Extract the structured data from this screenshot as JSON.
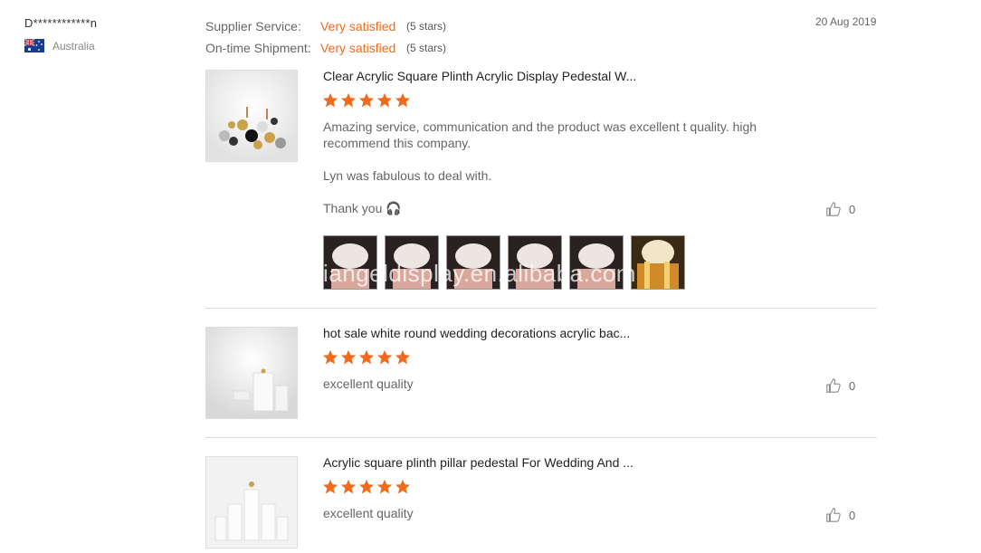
{
  "buyer": {
    "name": "D************n",
    "country": "Australia",
    "flag_icon": "australia-flag-icon"
  },
  "ratings": [
    {
      "label": "Supplier Service:",
      "value": "Very satisfied",
      "stars": "(5 stars)"
    },
    {
      "label": "On-time Shipment:",
      "value": "Very satisfied",
      "stars": "(5 stars)"
    }
  ],
  "date": "20 Aug 2019",
  "reviews": [
    {
      "title": "Clear Acrylic Square Plinth Acrylic Display Pedestal W...",
      "rating": 5,
      "paragraphs": [
        "Amazing service, communication and the product was excellent t quality. high recommend this company.",
        "Lyn was fabulous to deal with.",
        "Thank you 🎧"
      ],
      "likes": "0",
      "photo_count": 6
    },
    {
      "title": "hot sale white round wedding decorations acrylic bac...",
      "rating": 5,
      "paragraphs": [
        "excellent quality"
      ],
      "likes": "0"
    },
    {
      "title": "Acrylic square plinth pillar pedestal For Wedding And ...",
      "rating": 5,
      "paragraphs": [
        "excellent quality"
      ],
      "likes": "0"
    }
  ],
  "watermark": "iangeldisplay.en.alibaba.com",
  "colors": {
    "accent": "#f06a1c",
    "star": "#f06a1c",
    "divider": "#dcdcdc"
  }
}
